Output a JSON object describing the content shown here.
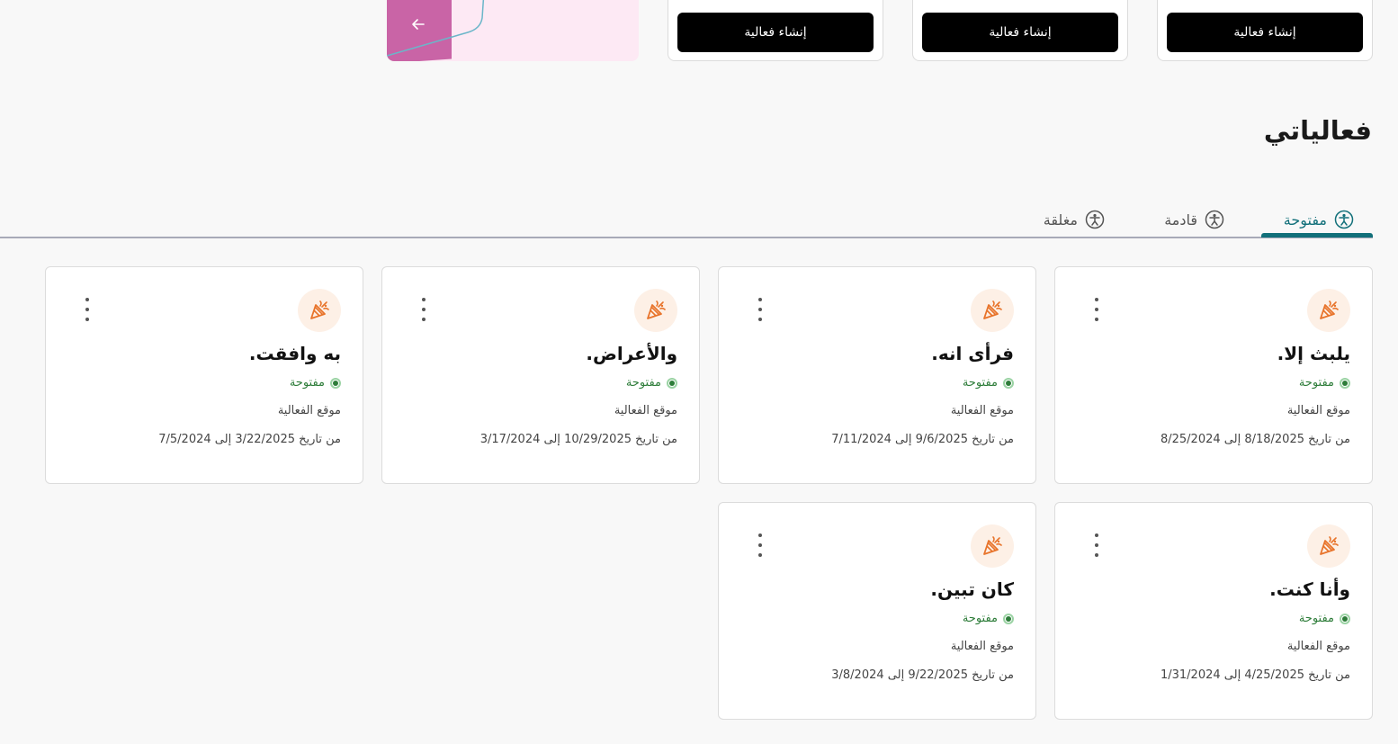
{
  "create_cards": [
    {
      "button_label": "إنشاء فعالية"
    },
    {
      "button_label": "إنشاء فعالية"
    },
    {
      "button_label": "إنشاء فعالية"
    }
  ],
  "promo": {
    "arrow_icon": "arrow-left-icon",
    "color": "#c964a6",
    "background": "#fde9f4"
  },
  "section": {
    "title": "فعالياتي"
  },
  "tabs": [
    {
      "label": "مفتوحة",
      "icon": "person-circle-icon",
      "active": true
    },
    {
      "label": "قادمة",
      "icon": "person-circle-icon",
      "active": false
    },
    {
      "label": "مغلقة",
      "icon": "person-circle-icon",
      "active": false
    }
  ],
  "colors": {
    "accent": "#12707a",
    "status_open": "#2e7d3a",
    "icon_orange": "#e8742b"
  },
  "events": [
    {
      "title": "يلبث إلا.",
      "status": "مفتوحة",
      "location": "موقع الفعالية",
      "dates": "من تاريخ 8/18/2025 إلى 8/25/2024"
    },
    {
      "title": "فرأى انه.",
      "status": "مفتوحة",
      "location": "موقع الفعالية",
      "dates": "من تاريخ 9/6/2025 إلى 7/11/2024"
    },
    {
      "title": "والأعراض.",
      "status": "مفتوحة",
      "location": "موقع الفعالية",
      "dates": "من تاريخ 10/29/2025 إلى 3/17/2024"
    },
    {
      "title": "به وافقت.",
      "status": "مفتوحة",
      "location": "موقع الفعالية",
      "dates": "من تاريخ 3/22/2025 إلى 7/5/2024"
    },
    {
      "title": "وأنا كنت.",
      "status": "مفتوحة",
      "location": "موقع الفعالية",
      "dates": "من تاريخ 4/25/2025 إلى 1/31/2024"
    },
    {
      "title": "كان تبين.",
      "status": "مفتوحة",
      "location": "موقع الفعالية",
      "dates": "من تاريخ 9/22/2025 إلى 3/8/2024"
    }
  ]
}
